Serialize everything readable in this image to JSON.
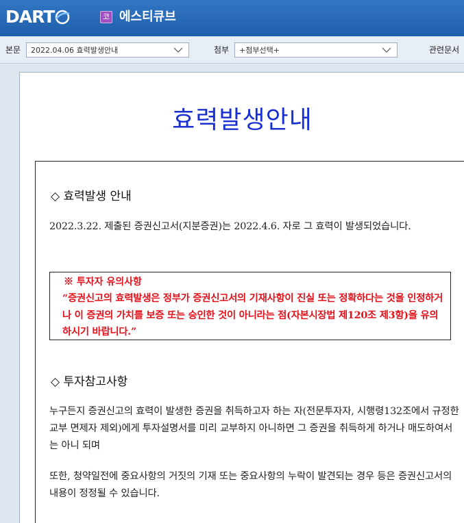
{
  "header": {
    "logo_text": "DART",
    "company_badge": "코",
    "company_name": "에스티큐브"
  },
  "toolbar": {
    "body_label": "본문",
    "body_select_value": "2022.04.06  효력발생안내",
    "attach_label": "첨부",
    "attach_select_value": "+첨부선택+",
    "related_label": "관련문서"
  },
  "document": {
    "title": "효력발생안내",
    "section1_heading": "◇ 효력발생 안내",
    "section1_text": "2022.3.22. 제출된 증권신고서(지분증권)는 2022.4.6. 자로 그 효력이 발생되었습니다.",
    "warning_title": "※ 투자자 유의사항",
    "warning_text": "“증권신고의 효력발생은 정부가 증권신고서의 기재사항이 진실 또는 정확하다는 것을 인정하거나 이 증권의 가치를 보증 또는 승인한 것이 아니라는 점(자본시장법 제120조 제3항)을 유의하시기 바랍니다.”",
    "section2_heading": "◇ 투자참고사항",
    "section2_text1": "누구든지 증권신고의 효력이 발생한 증권을 취득하고자 하는 자(전문투자자, 시행령132조에서 규정한 교부 면제자 제외)에게 투자설명서를 미리 교부하지 아니하면 그 증권을 취득하게 하거나 매도하여서는 아니 되며",
    "section2_text2": "또한, 청약일전에 중요사항의 거짓의 기재 또는 중요사항의 누락이 발견되는 경우 등은 증권신고서의 내용이 정정될 수 있습니다."
  },
  "colors": {
    "header_blue": "#2667b3",
    "title_blue": "#1a2fd0",
    "warning_red": "#e0121b",
    "badge_purple": "#a14fc2"
  }
}
